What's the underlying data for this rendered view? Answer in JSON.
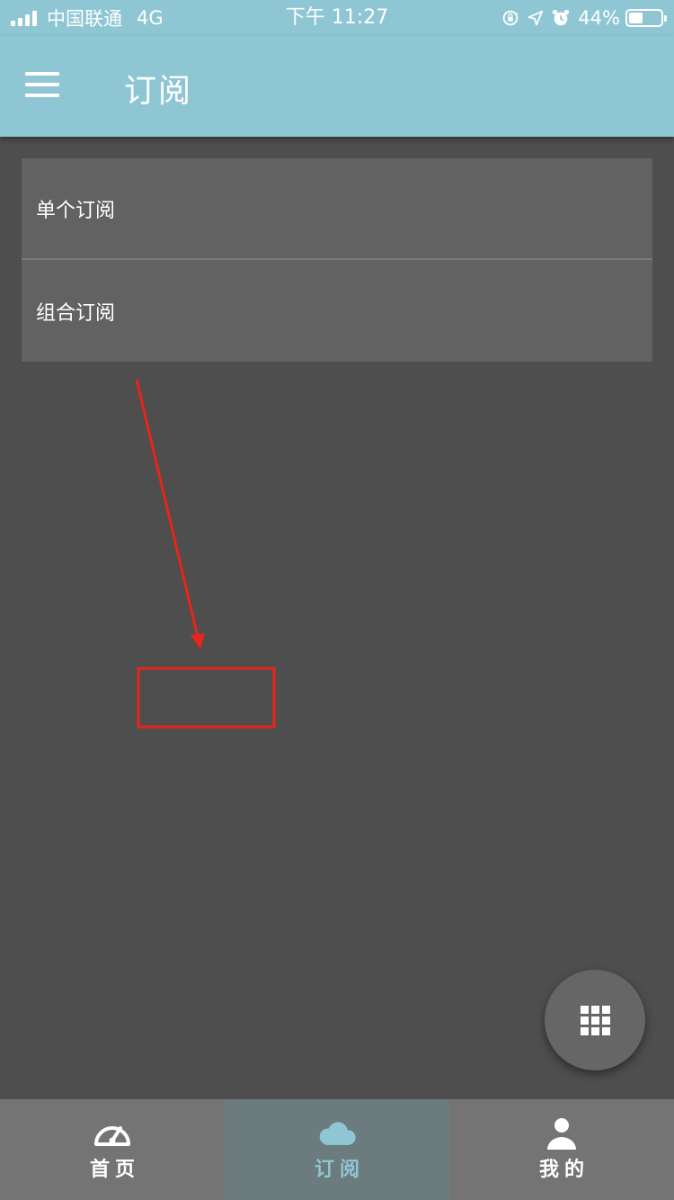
{
  "status_bar": {
    "carrier": "中国联通",
    "network": "4G",
    "time": "下午 11:27",
    "battery_percent": "44%",
    "battery_level": 0.44,
    "icons": [
      "orientation-lock-icon",
      "location-icon",
      "alarm-icon"
    ]
  },
  "header": {
    "menu_icon": "hamburger-menu-icon",
    "title": "订阅"
  },
  "list": {
    "items": [
      {
        "label": "单个订阅"
      },
      {
        "label": "组合订阅"
      }
    ]
  },
  "annotation": {
    "color": "#e8241b",
    "shapes": [
      "arrow",
      "rectangle"
    ]
  },
  "fab": {
    "icon": "grid-apps-icon"
  },
  "tabbar": {
    "tabs": [
      {
        "label": "首页",
        "icon": "speedometer-icon",
        "active": false
      },
      {
        "label": "订阅",
        "icon": "cloud-icon",
        "active": true
      },
      {
        "label": "我的",
        "icon": "person-icon",
        "active": false
      }
    ]
  },
  "colors": {
    "accent": "#8ec7d3",
    "background": "#4e4e4e",
    "card": "#626262",
    "tabbar": "#747474"
  }
}
